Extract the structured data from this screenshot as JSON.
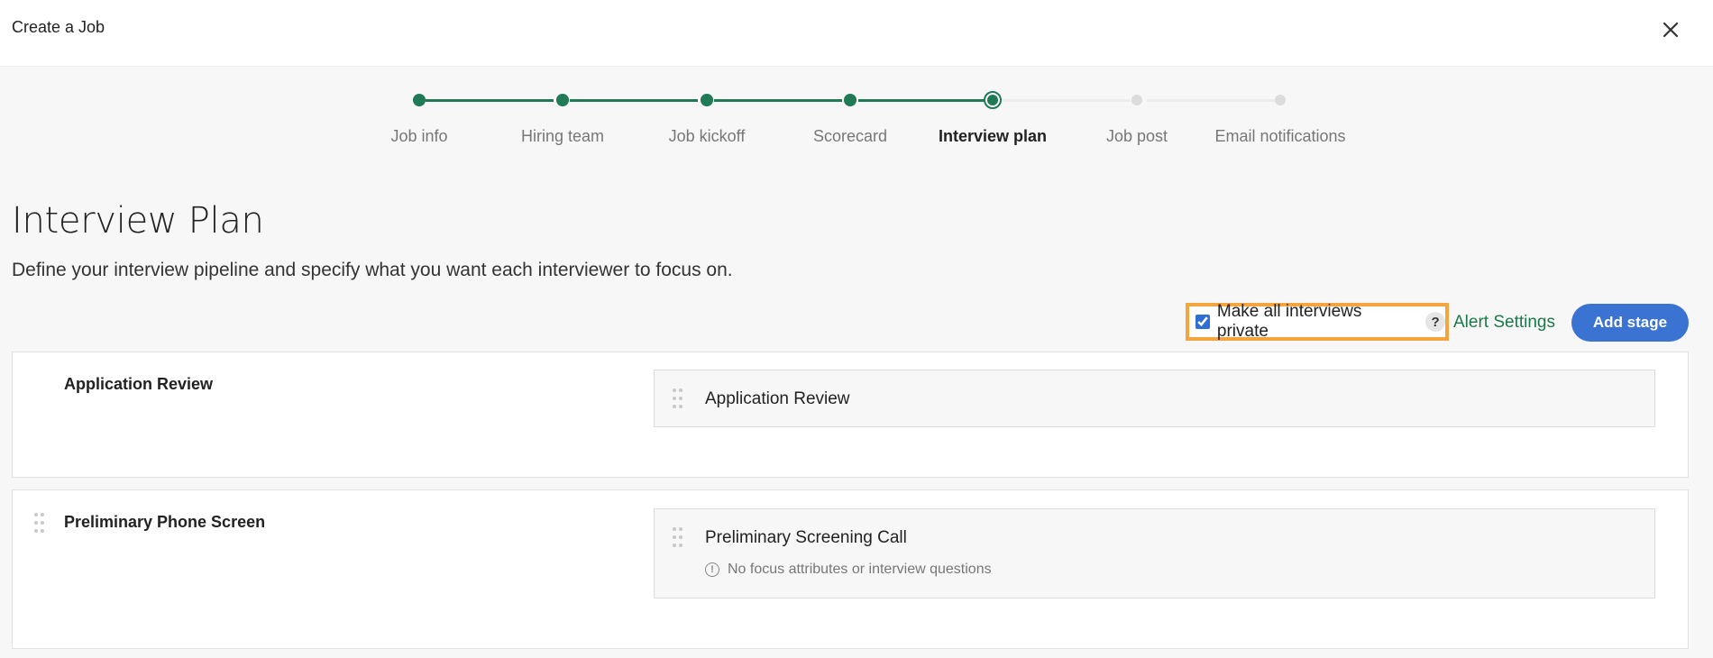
{
  "header": {
    "title": "Create a Job"
  },
  "stepper": {
    "steps": [
      {
        "label": "Job info",
        "state": "done"
      },
      {
        "label": "Hiring team",
        "state": "done"
      },
      {
        "label": "Job kickoff",
        "state": "done"
      },
      {
        "label": "Scorecard",
        "state": "done"
      },
      {
        "label": "Interview plan",
        "state": "active"
      },
      {
        "label": "Job post",
        "state": "pending"
      },
      {
        "label": "Email notifications",
        "state": "pending"
      }
    ]
  },
  "page": {
    "title": "Interview Plan",
    "subtitle": "Define your interview pipeline and specify what you want each interviewer to focus on."
  },
  "actions": {
    "private_label": "Make all interviews private",
    "private_checked": true,
    "help_label": "?",
    "alert_settings": "Alert Settings",
    "add_stage": "Add stage"
  },
  "stages": [
    {
      "title": "Application Review",
      "interviews": [
        {
          "name": "Application Review",
          "note": ""
        }
      ]
    },
    {
      "title": "Preliminary Phone Screen",
      "interviews": [
        {
          "name": "Preliminary Screening Call",
          "note": "No focus attributes or interview questions"
        }
      ]
    }
  ],
  "colors": {
    "accent_green": "#1f7a55",
    "primary_blue": "#3b73d3",
    "highlight_orange": "#f4a540"
  },
  "icons": {
    "close": "close-icon",
    "drag": "drag-handle-icon",
    "info": "info-icon",
    "help": "help-icon"
  }
}
